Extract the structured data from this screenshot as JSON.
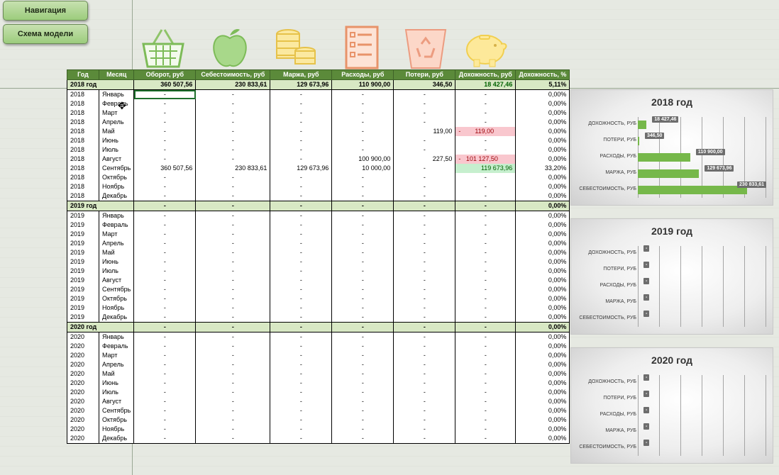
{
  "nav_button": "Навигация",
  "model_button": "Схема модели",
  "icons": [
    "basket-icon",
    "apple-icon",
    "coins-icon",
    "checklist-icon",
    "trash-recycle-icon",
    "piggy-bank-icon"
  ],
  "headers": [
    "Год",
    "Месяц",
    "Оборот, руб",
    "Себестоимость, руб",
    "Маржа, руб",
    "Расходы, руб",
    "Потери, руб",
    "Дохожность, руб",
    "Дохожность, %"
  ],
  "years": [
    {
      "label": "2018 год",
      "totals": [
        "360 507,56",
        "230 833,61",
        "129 673,96",
        "110 900,00",
        "346,50",
        "18 427,46",
        "5,11%"
      ],
      "rows": [
        [
          "2018",
          "Январь",
          "-",
          "-",
          "-",
          "-",
          "-",
          "-",
          "0,00%"
        ],
        [
          "2018",
          "Февраль",
          "-",
          "-",
          "-",
          "-",
          "-",
          "-",
          "0,00%"
        ],
        [
          "2018",
          "Март",
          "-",
          "-",
          "-",
          "-",
          "-",
          "-",
          "0,00%"
        ],
        [
          "2018",
          "Апрель",
          "-",
          "-",
          "-",
          "-",
          "-",
          "-",
          "0,00%"
        ],
        [
          "2018",
          "Май",
          "-",
          "-",
          "-",
          "-",
          "119,00",
          "-        119,00",
          "0,00%"
        ],
        [
          "2018",
          "Июнь",
          "-",
          "-",
          "-",
          "-",
          "-",
          "-",
          "0,00%"
        ],
        [
          "2018",
          "Июль",
          "-",
          "-",
          "-",
          "-",
          "-",
          "-",
          "0,00%"
        ],
        [
          "2018",
          "Август",
          "-",
          "-",
          "-",
          "100 900,00",
          "227,50",
          "-   101 127,50",
          "0,00%"
        ],
        [
          "2018",
          "Сентябрь",
          "360 507,56",
          "230 833,61",
          "129 673,96",
          "10 000,00",
          "-",
          "119 673,96",
          "33,20%"
        ],
        [
          "2018",
          "Октябрь",
          "-",
          "-",
          "-",
          "-",
          "-",
          "-",
          "0,00%"
        ],
        [
          "2018",
          "Ноябрь",
          "-",
          "-",
          "-",
          "-",
          "-",
          "-",
          "0,00%"
        ],
        [
          "2018",
          "Декабрь",
          "-",
          "-",
          "-",
          "-",
          "-",
          "-",
          "0,00%"
        ]
      ]
    },
    {
      "label": "2019 год",
      "totals": [
        "-",
        "-",
        "-",
        "-",
        "-",
        "-",
        "0,00%"
      ],
      "rows": [
        [
          "2019",
          "Январь",
          "-",
          "-",
          "-",
          "-",
          "-",
          "-",
          "0,00%"
        ],
        [
          "2019",
          "Февраль",
          "-",
          "-",
          "-",
          "-",
          "-",
          "-",
          "0,00%"
        ],
        [
          "2019",
          "Март",
          "-",
          "-",
          "-",
          "-",
          "-",
          "-",
          "0,00%"
        ],
        [
          "2019",
          "Апрель",
          "-",
          "-",
          "-",
          "-",
          "-",
          "-",
          "0,00%"
        ],
        [
          "2019",
          "Май",
          "-",
          "-",
          "-",
          "-",
          "-",
          "-",
          "0,00%"
        ],
        [
          "2019",
          "Июнь",
          "-",
          "-",
          "-",
          "-",
          "-",
          "-",
          "0,00%"
        ],
        [
          "2019",
          "Июль",
          "-",
          "-",
          "-",
          "-",
          "-",
          "-",
          "0,00%"
        ],
        [
          "2019",
          "Август",
          "-",
          "-",
          "-",
          "-",
          "-",
          "-",
          "0,00%"
        ],
        [
          "2019",
          "Сентябрь",
          "-",
          "-",
          "-",
          "-",
          "-",
          "-",
          "0,00%"
        ],
        [
          "2019",
          "Октябрь",
          "-",
          "-",
          "-",
          "-",
          "-",
          "-",
          "0,00%"
        ],
        [
          "2019",
          "Ноябрь",
          "-",
          "-",
          "-",
          "-",
          "-",
          "-",
          "0,00%"
        ],
        [
          "2019",
          "Декабрь",
          "-",
          "-",
          "-",
          "-",
          "-",
          "-",
          "0,00%"
        ]
      ]
    },
    {
      "label": "2020 год",
      "totals": [
        "-",
        "-",
        "-",
        "-",
        "-",
        "-",
        "0,00%"
      ],
      "rows": [
        [
          "2020",
          "Январь",
          "-",
          "-",
          "-",
          "-",
          "-",
          "-",
          "0,00%"
        ],
        [
          "2020",
          "Февраль",
          "-",
          "-",
          "-",
          "-",
          "-",
          "-",
          "0,00%"
        ],
        [
          "2020",
          "Март",
          "-",
          "-",
          "-",
          "-",
          "-",
          "-",
          "0,00%"
        ],
        [
          "2020",
          "Апрель",
          "-",
          "-",
          "-",
          "-",
          "-",
          "-",
          "0,00%"
        ],
        [
          "2020",
          "Май",
          "-",
          "-",
          "-",
          "-",
          "-",
          "-",
          "0,00%"
        ],
        [
          "2020",
          "Июнь",
          "-",
          "-",
          "-",
          "-",
          "-",
          "-",
          "0,00%"
        ],
        [
          "2020",
          "Июль",
          "-",
          "-",
          "-",
          "-",
          "-",
          "-",
          "0,00%"
        ],
        [
          "2020",
          "Август",
          "-",
          "-",
          "-",
          "-",
          "-",
          "-",
          "0,00%"
        ],
        [
          "2020",
          "Сентябрь",
          "-",
          "-",
          "-",
          "-",
          "-",
          "-",
          "0,00%"
        ],
        [
          "2020",
          "Октябрь",
          "-",
          "-",
          "-",
          "-",
          "-",
          "-",
          "0,00%"
        ],
        [
          "2020",
          "Ноябрь",
          "-",
          "-",
          "-",
          "-",
          "-",
          "-",
          "0,00%"
        ],
        [
          "2020",
          "Декабрь",
          "-",
          "-",
          "-",
          "-",
          "-",
          "-",
          "0,00%"
        ]
      ]
    }
  ],
  "chart_data": [
    {
      "type": "bar",
      "orientation": "horizontal",
      "title": "2018 год",
      "categories": [
        "ДОХОЖНОСТЬ, РУБ",
        "ПОТЕРИ, РУБ",
        "РАСХОДЫ, РУБ",
        "МАРЖА, РУБ",
        "СЕБЕСТОИМОСТЬ, РУБ"
      ],
      "values": [
        18427.46,
        346.5,
        110900.0,
        129673.96,
        230833.61
      ],
      "labels": [
        "18 427,46",
        "346,50",
        "110 900,00",
        "129 673,96",
        "230 833,61"
      ],
      "xlim": [
        0,
        270000
      ],
      "bar_color": "#76b84a"
    },
    {
      "type": "bar",
      "orientation": "horizontal",
      "title": "2019 год",
      "categories": [
        "ДОХОЖНОСТЬ, РУБ",
        "ПОТЕРИ, РУБ",
        "РАСХОДЫ, РУБ",
        "МАРЖА, РУБ",
        "СЕБЕСТОИМОСТЬ, РУБ"
      ],
      "values": [
        0,
        0,
        0,
        0,
        0
      ],
      "labels": [
        "-",
        "-",
        "-",
        "-",
        "-"
      ],
      "xlim": [
        0,
        1
      ],
      "bar_color": "#76b84a"
    },
    {
      "type": "bar",
      "orientation": "horizontal",
      "title": "2020 год",
      "categories": [
        "ДОХОЖНОСТЬ, РУБ",
        "ПОТЕРИ, РУБ",
        "РАСХОДЫ, РУБ",
        "МАРЖА, РУБ",
        "СЕБЕСТОИМОСТЬ, РУБ"
      ],
      "values": [
        0,
        0,
        0,
        0,
        0
      ],
      "labels": [
        "-",
        "-",
        "-",
        "-",
        "-"
      ],
      "xlim": [
        0,
        1
      ],
      "bar_color": "#76b84a"
    }
  ]
}
